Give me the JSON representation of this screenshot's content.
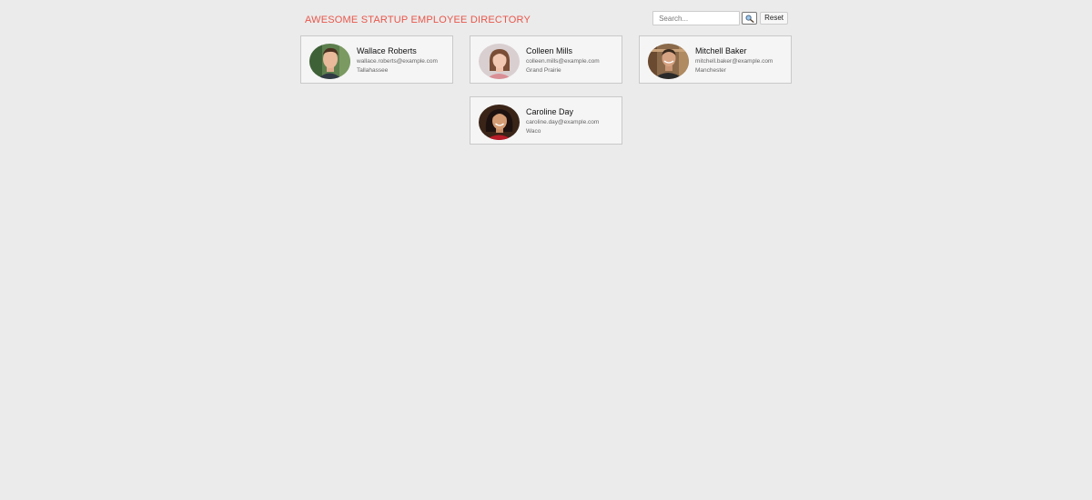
{
  "header": {
    "title": "AWESOME STARTUP EMPLOYEE DIRECTORY"
  },
  "search": {
    "placeholder": "Search...",
    "button_icon": "magnifier-icon",
    "reset_label": "Reset"
  },
  "employees": [
    {
      "name": "Wallace Roberts",
      "email": "wallace.roberts@example.com",
      "city": "Tallahassee"
    },
    {
      "name": "Colleen Mills",
      "email": "colleen.mills@example.com",
      "city": "Grand Prairie"
    },
    {
      "name": "Mitchell Baker",
      "email": "mitchell.baker@example.com",
      "city": "Manchester"
    },
    {
      "name": "Caroline Day",
      "email": "caroline.day@example.com",
      "city": "Waco"
    }
  ],
  "colors": {
    "background": "#ebebeb",
    "title_accent": "#e8574b",
    "card_background": "#f5f5f5",
    "card_border": "#c9c9c9"
  }
}
